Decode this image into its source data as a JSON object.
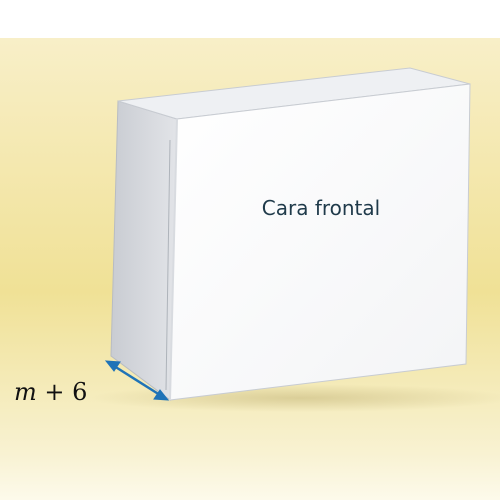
{
  "box": {
    "front_face_label": "Cara frontal"
  },
  "dimension": {
    "variable": "m",
    "operator": "+",
    "constant": "6"
  },
  "colors": {
    "background_top": "#f7eec7",
    "background_mid": "#f1e29a",
    "background_bottom": "#fbf6df",
    "box_front": "#ffffff",
    "box_side": "#d4d7dc",
    "box_top": "#eef0f3",
    "arrow": "#1f73b7",
    "label_text": "#1f3a4a"
  }
}
